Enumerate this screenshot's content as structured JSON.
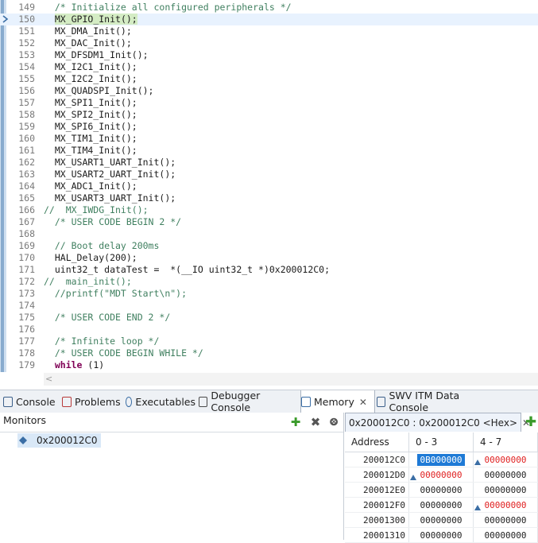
{
  "editor": {
    "lines": [
      {
        "num": "149",
        "text": "  /* Initialize all configured peripherals */",
        "type": "comment"
      },
      {
        "num": "150",
        "text": "MX_GPIO_Init();",
        "type": "highlight",
        "indent": "  "
      },
      {
        "num": "151",
        "text": "  MX_DMA_Init();",
        "type": "code"
      },
      {
        "num": "152",
        "text": "  MX_DAC_Init();",
        "type": "code"
      },
      {
        "num": "153",
        "text": "  MX_DFSDM1_Init();",
        "type": "code"
      },
      {
        "num": "154",
        "text": "  MX_I2C1_Init();",
        "type": "code"
      },
      {
        "num": "155",
        "text": "  MX_I2C2_Init();",
        "type": "code"
      },
      {
        "num": "156",
        "text": "  MX_QUADSPI_Init();",
        "type": "code"
      },
      {
        "num": "157",
        "text": "  MX_SPI1_Init();",
        "type": "code"
      },
      {
        "num": "158",
        "text": "  MX_SPI2_Init();",
        "type": "code"
      },
      {
        "num": "159",
        "text": "  MX_SPI6_Init();",
        "type": "code"
      },
      {
        "num": "160",
        "text": "  MX_TIM1_Init();",
        "type": "code"
      },
      {
        "num": "161",
        "text": "  MX_TIM4_Init();",
        "type": "code"
      },
      {
        "num": "162",
        "text": "  MX_USART1_UART_Init();",
        "type": "code"
      },
      {
        "num": "163",
        "text": "  MX_USART2_UART_Init();",
        "type": "code"
      },
      {
        "num": "164",
        "text": "  MX_ADC1_Init();",
        "type": "code"
      },
      {
        "num": "165",
        "text": "  MX_USART3_UART_Init();",
        "type": "code"
      },
      {
        "num": "166",
        "text": "//  MX_IWDG_Init();",
        "type": "comment"
      },
      {
        "num": "167",
        "text": "  /* USER CODE BEGIN 2 */",
        "type": "comment"
      },
      {
        "num": "168",
        "text": "",
        "type": "code"
      },
      {
        "num": "169",
        "text": "  // Boot delay 200ms",
        "type": "comment"
      },
      {
        "num": "170",
        "text": "  HAL_Delay(200);",
        "type": "code"
      },
      {
        "num": "171",
        "text": "  uint32_t dataTest =  *(__IO uint32_t *)0x200012C0;",
        "type": "code"
      },
      {
        "num": "172",
        "text": "//  main_init();",
        "type": "comment"
      },
      {
        "num": "173",
        "text": "  //printf(\"MDT Start\\n\");",
        "type": "comment"
      },
      {
        "num": "174",
        "text": "",
        "type": "code"
      },
      {
        "num": "175",
        "text": "  /* USER CODE END 2 */",
        "type": "comment"
      },
      {
        "num": "176",
        "text": "",
        "type": "code"
      },
      {
        "num": "177",
        "text": "  /* Infinite loop */",
        "type": "comment"
      },
      {
        "num": "178",
        "text": "  /* USER CODE BEGIN WHILE */",
        "type": "comment"
      },
      {
        "num": "179",
        "kw": "while",
        "text": " (1)",
        "type": "keyword",
        "indent": "  "
      }
    ]
  },
  "tabs": [
    {
      "label": "Console",
      "icon": "console-icon"
    },
    {
      "label": "Problems",
      "icon": "problems-icon"
    },
    {
      "label": "Executables",
      "icon": "executables-icon"
    },
    {
      "label": "Debugger Console",
      "icon": "debugger-console-icon"
    },
    {
      "label": "Memory",
      "icon": "memory-icon",
      "active": true
    },
    {
      "label": "SWV ITM Data Console",
      "icon": "swv-console-icon"
    }
  ],
  "monitors": {
    "title": "Monitors",
    "items": [
      "0x200012C0"
    ]
  },
  "rendering": {
    "tab_label": "0x200012C0 : 0x200012C0 <Hex>",
    "columns": [
      "Address",
      "0 - 3",
      "4 - 7"
    ],
    "rows": [
      {
        "addr": "200012C0",
        "c1": "0B000000",
        "c2": "00000000"
      },
      {
        "addr": "200012D0",
        "c1": "00000000",
        "c2": "00000000"
      },
      {
        "addr": "200012E0",
        "c1": "00000000",
        "c2": "00000000"
      },
      {
        "addr": "200012F0",
        "c1": "00000000",
        "c2": "00000000"
      },
      {
        "addr": "20001300",
        "c1": "00000000",
        "c2": "00000000"
      },
      {
        "addr": "20001310",
        "c1": "00000000",
        "c2": "00000000"
      }
    ]
  },
  "colors": {
    "accent": "#1e7ad6",
    "changed": "#e02020",
    "comment": "#3f7f5f",
    "keyword": "#7f0055"
  }
}
